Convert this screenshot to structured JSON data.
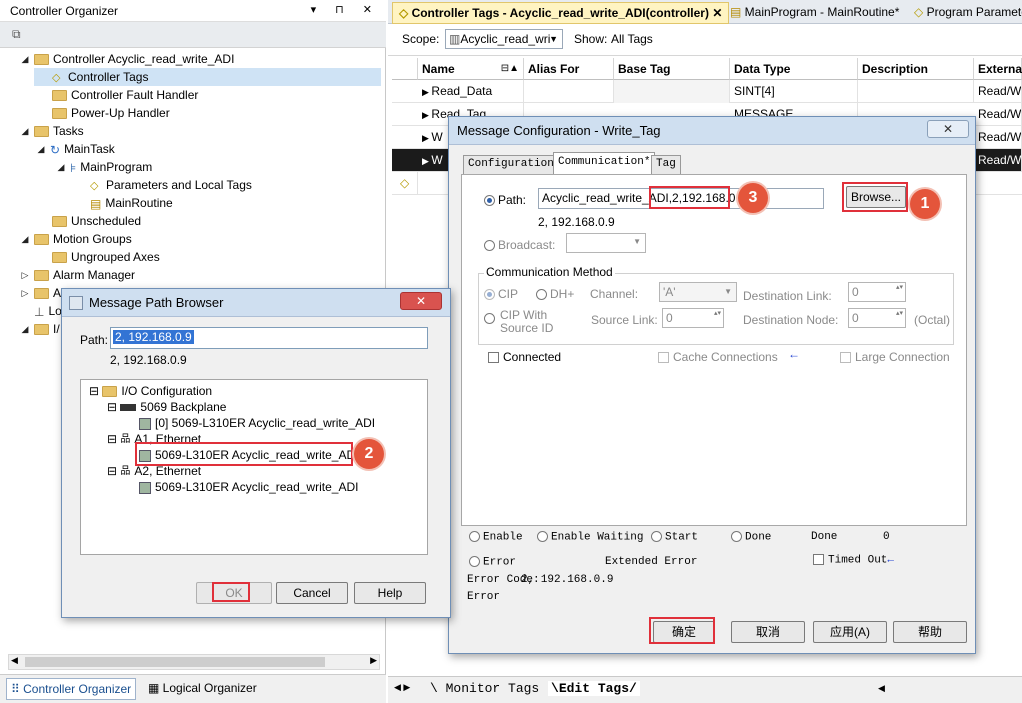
{
  "left_panel": {
    "title": "Controller Organizer",
    "title_buttons": "▾ ⊓ ✕",
    "tree": [
      {
        "label": "Controller Acyclic_read_write_ADI"
      },
      {
        "label": "Controller Tags"
      },
      {
        "label": "Controller Fault Handler"
      },
      {
        "label": "Power-Up Handler"
      },
      {
        "label": "Tasks"
      },
      {
        "label": "MainTask"
      },
      {
        "label": "MainProgram"
      },
      {
        "label": "Parameters and Local Tags"
      },
      {
        "label": "MainRoutine"
      },
      {
        "label": "Unscheduled"
      },
      {
        "label": "Motion Groups"
      },
      {
        "label": "Ungrouped Axes"
      },
      {
        "label": "Alarm Manager"
      },
      {
        "label": "A"
      },
      {
        "label": "Lo"
      },
      {
        "label": "I/"
      }
    ],
    "bottom_tabs": [
      "Controller Organizer",
      "Logical Organizer"
    ]
  },
  "doc_tabs": [
    {
      "label": "Controller Tags - Acyclic_read_write_ADI(controller)",
      "active": true
    },
    {
      "label": "MainProgram - MainRoutine*"
    },
    {
      "label": "Program Parameters"
    }
  ],
  "scope_bar": {
    "scope_label": "Scope:",
    "scope_value": "Acyclic_read_wri",
    "show_label": "Show:",
    "show_value": "All Tags"
  },
  "tag_grid": {
    "headers": [
      "Name",
      "Alias For",
      "Base Tag",
      "Data Type",
      "Description",
      "External"
    ],
    "rows": [
      {
        "name": "Read_Data",
        "data_type": "SINT[4]",
        "external": "Read/Wr"
      },
      {
        "name": "Read_Tag",
        "data_type": "MESSAGE",
        "external": "Read/Wr"
      },
      {
        "name": "W",
        "data_type": "",
        "external": "Read/Wr"
      },
      {
        "name": "W",
        "data_type": "",
        "external": "Read/Wr"
      }
    ]
  },
  "bottom_tabs": [
    "Monitor Tags",
    "Edit Tags"
  ],
  "message_config": {
    "title": "Message Configuration - Write_Tag",
    "close": "✕",
    "tabs": [
      "Configuration",
      "Communication*",
      "Tag"
    ],
    "path_label": "Path:",
    "path_value": "Acyclic_read_write_ADI",
    "path_highlight": ",2,192.168.0.9",
    "path_resolved": "2, 192.168.0.9",
    "browse_label": "Browse...",
    "broadcast_label": "Broadcast:",
    "comm_method_label": "Communication Method",
    "cip": "CIP",
    "dh": "DH+",
    "channel_label": "Channel:",
    "channel_value": "'A'",
    "dest_link_label": "Destination Link:",
    "dest_link_value": "0",
    "cip_with_source_id": "CIP With\nSource ID",
    "source_link_label": "Source Link:",
    "source_link_value": "0",
    "dest_node_label": "Destination Node:",
    "dest_node_value": "0",
    "octal": "(Octal)",
    "connected": "Connected",
    "cache_connections": "Cache Connections",
    "arrow": "←",
    "large_connection": "Large Connection",
    "status": {
      "enable": "Enable",
      "enable_waiting": "Enable Waiting",
      "start": "Start",
      "done": "Done",
      "done_label": "Done",
      "done_value": "0",
      "error": "Error",
      "extended_error": "Extended Error",
      "timed_out": "Timed Out",
      "error_code_label": "Error Code:",
      "error_code_value": "2, 192.168.0.9",
      "error_path": "Error"
    },
    "buttons": [
      "确定",
      "取消",
      "应用(A)",
      "帮助"
    ]
  },
  "path_browser": {
    "title": "Message Path Browser",
    "close": "✕",
    "path_label": "Path:",
    "path_value": "2, 192.168.0.9",
    "path_resolved": "2, 192.168.0.9",
    "tree": [
      "I/O Configuration",
      "5069 Backplane",
      "[0] 5069-L310ER Acyclic_read_write_ADI",
      "A1, Ethernet",
      "5069-L310ER Acyclic_read_write_ADI",
      "A2, Ethernet",
      "5069-L310ER Acyclic_read_write_ADI"
    ],
    "buttons": [
      "OK",
      "Cancel",
      "Help"
    ]
  },
  "annotations": [
    "1",
    "2",
    "3"
  ],
  "colors": {
    "highlight_red": "#e0303a",
    "badge": "#e4553b",
    "active_tab": "#fff4c2"
  }
}
